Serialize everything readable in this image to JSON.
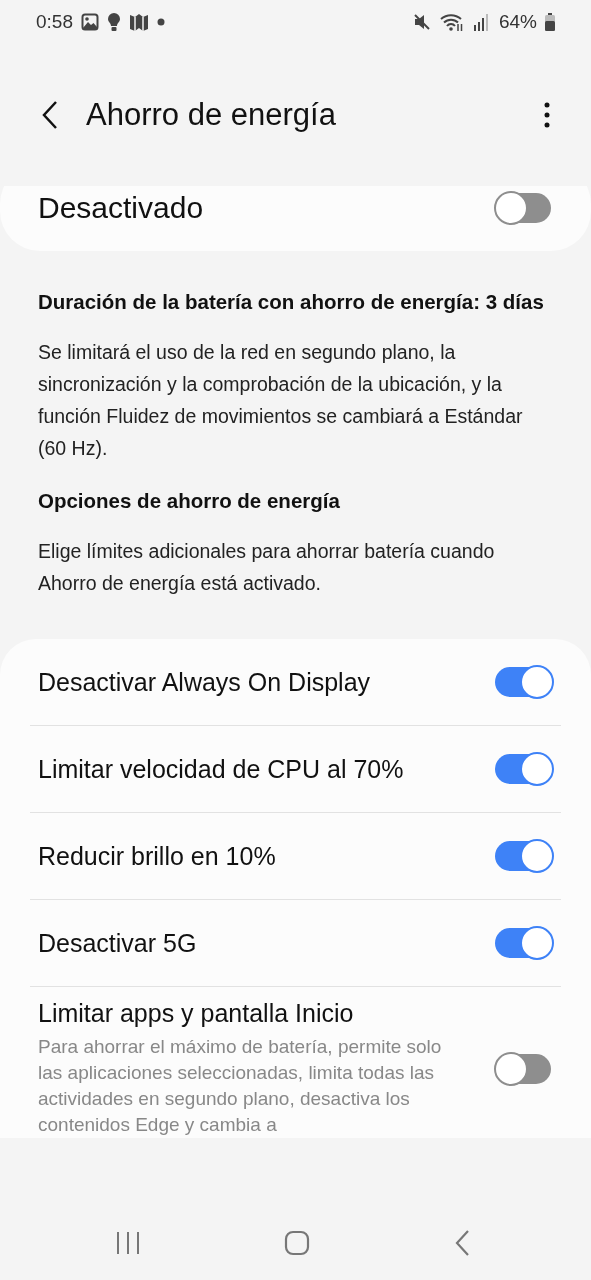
{
  "status_bar": {
    "time": "0:58",
    "battery": "64%"
  },
  "header": {
    "title": "Ahorro de energía"
  },
  "master": {
    "label": "Desactivado",
    "on": false
  },
  "info": {
    "heading": "Duración de la batería con ahorro de energía: 3 días",
    "body": "Se limitará el uso de la red en segundo plano, la sincronización y la comprobación de la ubicación, y la función Fluidez de movimientos se cambiará a Estándar (60 Hz)."
  },
  "options_info": {
    "heading": "Opciones de ahorro de energía",
    "body": "Elige límites adicionales para ahorrar batería cuando Ahorro de energía está activado."
  },
  "options": [
    {
      "label": "Desactivar Always On Display",
      "on": true
    },
    {
      "label": "Limitar velocidad de CPU al 70%",
      "on": true
    },
    {
      "label": "Reducir brillo en 10%",
      "on": true
    },
    {
      "label": "Desactivar 5G",
      "on": true
    },
    {
      "label": "Limitar apps y pantalla Inicio",
      "description": "Para ahorrar el máximo de batería, permite solo las aplicaciones seleccionadas, limita todas las actividades en segundo plano, desactiva los contenidos Edge y cambia a",
      "on": false
    }
  ]
}
